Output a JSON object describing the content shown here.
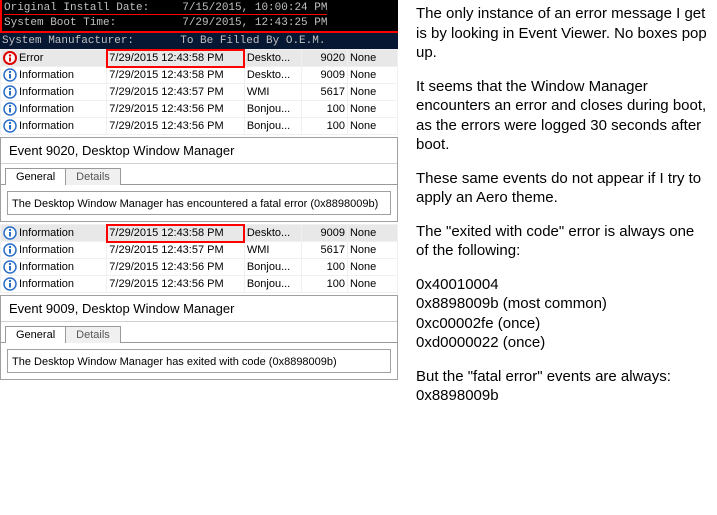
{
  "cmd": {
    "line1": "Original Install Date:     7/15/2015, 10:00:24 PM",
    "line2": "System Boot Time:          7/29/2015, 12:43:25 PM",
    "line3": "System Manufacturer:       To Be Filled By O.E.M."
  },
  "events1": [
    {
      "level": "Error",
      "date": "7/29/2015 12:43:58 PM",
      "source": "Deskto...",
      "id": "9020",
      "cat": "None"
    },
    {
      "level": "Information",
      "date": "7/29/2015 12:43:58 PM",
      "source": "Deskto...",
      "id": "9009",
      "cat": "None"
    },
    {
      "level": "Information",
      "date": "7/29/2015 12:43:57 PM",
      "source": "WMI",
      "id": "5617",
      "cat": "None"
    },
    {
      "level": "Information",
      "date": "7/29/2015 12:43:56 PM",
      "source": "Bonjou...",
      "id": "100",
      "cat": "None"
    },
    {
      "level": "Information",
      "date": "7/29/2015 12:43:56 PM",
      "source": "Bonjou...",
      "id": "100",
      "cat": "None"
    }
  ],
  "pane1": {
    "header": "Event 9020, Desktop Window Manager",
    "tabs": {
      "general": "General",
      "details": "Details"
    },
    "message": "The Desktop Window Manager has encountered a fatal error (0x8898009b)"
  },
  "events2": [
    {
      "level": "Information",
      "date": "7/29/2015 12:43:58 PM",
      "source": "Deskto...",
      "id": "9009",
      "cat": "None"
    },
    {
      "level": "Information",
      "date": "7/29/2015 12:43:57 PM",
      "source": "WMI",
      "id": "5617",
      "cat": "None"
    },
    {
      "level": "Information",
      "date": "7/29/2015 12:43:56 PM",
      "source": "Bonjou...",
      "id": "100",
      "cat": "None"
    },
    {
      "level": "Information",
      "date": "7/29/2015 12:43:56 PM",
      "source": "Bonjou...",
      "id": "100",
      "cat": "None"
    }
  ],
  "pane2": {
    "header": "Event 9009, Desktop Window Manager",
    "tabs": {
      "general": "General",
      "details": "Details"
    },
    "message": "The Desktop Window Manager has exited with code (0x8898009b)"
  },
  "notes": {
    "p1": "The only instance of an error message I get is by looking in Event Viewer. No boxes pop up.",
    "p2": "It seems that the Window Manager encounters an error and closes during boot, as the errors were logged 30 seconds after boot.",
    "p3": "These same events do not appear if I try to apply an Aero theme.",
    "p4": "The \"exited with code\" error is always one of the following:",
    "c1": "0x40010004",
    "c2": "0x8898009b (most common)",
    "c3": "0xc00002fe (once)",
    "c4": "0xd0000022 (once)",
    "p5": "But the \"fatal error\" events are always: 0x8898009b"
  }
}
